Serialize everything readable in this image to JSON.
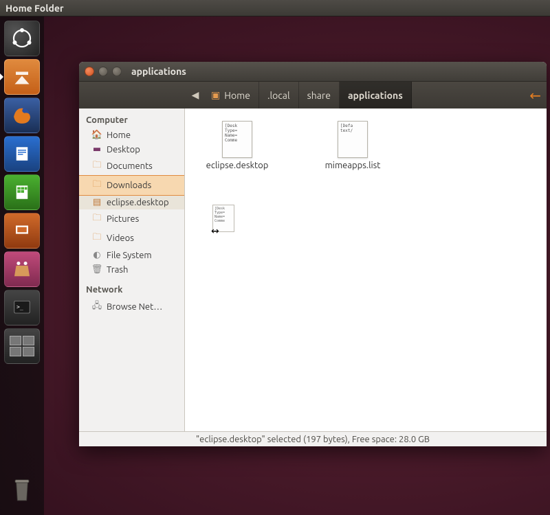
{
  "top_panel_title": "Home Folder",
  "launcher": {
    "items": [
      {
        "name": "dash",
        "tip": "Dash"
      },
      {
        "name": "files",
        "tip": "Files"
      },
      {
        "name": "firefox",
        "tip": "Firefox"
      },
      {
        "name": "writer",
        "tip": "LibreOffice Writer"
      },
      {
        "name": "calc",
        "tip": "LibreOffice Calc"
      },
      {
        "name": "impress",
        "tip": "LibreOffice Impress"
      },
      {
        "name": "software",
        "tip": "Software Center"
      },
      {
        "name": "terminal",
        "tip": "Terminal"
      },
      {
        "name": "workspace",
        "tip": "Workspace Switcher"
      }
    ],
    "trash_tip": "Trash"
  },
  "window": {
    "title": "applications",
    "breadcrumb": {
      "items": [
        "Home",
        ".local",
        "share",
        "applications"
      ],
      "active_index": 3
    },
    "sidebar": {
      "computer_head": "Computer",
      "network_head": "Network",
      "computer_items": [
        {
          "label": "Home",
          "icon": "home"
        },
        {
          "label": "Desktop",
          "icon": "desktop"
        },
        {
          "label": "Documents",
          "icon": "folder"
        },
        {
          "label": "Downloads",
          "icon": "folder",
          "hover": true
        },
        {
          "label": "eclipse.desktop",
          "icon": "file",
          "selected": true
        },
        {
          "label": "Pictures",
          "icon": "folder"
        },
        {
          "label": "Videos",
          "icon": "folder"
        },
        {
          "label": "File System",
          "icon": "disk"
        },
        {
          "label": "Trash",
          "icon": "trash"
        }
      ],
      "network_items": [
        {
          "label": "Browse Net…",
          "icon": "network"
        }
      ]
    },
    "files": [
      {
        "name": "eclipse.desktop",
        "preview": "[Desk\nType=\nName=\nComme"
      },
      {
        "name": "mimeapps.list",
        "preview": "[Defa\ntext/"
      }
    ],
    "status": "\"eclipse.desktop\" selected (197 bytes), Free space: 28.0 GB",
    "drag_ghost_preview": "[Desk\nType=\nName=\nComme"
  }
}
